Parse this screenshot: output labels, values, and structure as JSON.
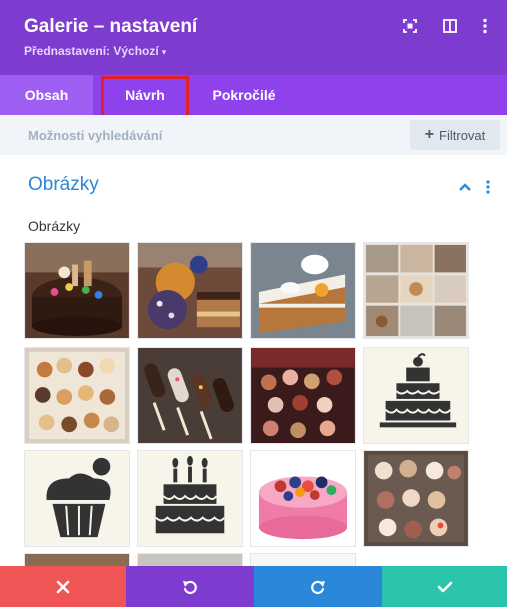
{
  "header": {
    "title": "Galerie – nastavení",
    "preset_label": "Přednastavení: Výchozí",
    "bg_color": "#7e3bd0"
  },
  "tabs": [
    {
      "label": "Obsah"
    },
    {
      "label": "Návrh",
      "highlighted": true
    },
    {
      "label": "Pokročilé"
    }
  ],
  "search": {
    "placeholder": "Možnosti vyhledávání",
    "filter_label": "Filtrovat"
  },
  "section": {
    "title": "Obrázky",
    "field_label": "Obrázky"
  },
  "images": [
    {
      "icon": "chocolate-cake-photo"
    },
    {
      "icon": "desserts-photo"
    },
    {
      "icon": "cake-slice-photo"
    },
    {
      "icon": "collage-photo"
    },
    {
      "icon": "cookies-box-photo"
    },
    {
      "icon": "chocolate-pops-photo"
    },
    {
      "icon": "chocolates-photo"
    },
    {
      "icon": "tiered-cake-icon"
    },
    {
      "icon": "cupcake-icon"
    },
    {
      "icon": "birthday-cake-icon"
    },
    {
      "icon": "berry-cake-photo"
    },
    {
      "icon": "cupcakes-box-photo"
    }
  ],
  "footer": {
    "buttons": [
      {
        "icon": "close-icon",
        "color": "#ef5555"
      },
      {
        "icon": "undo-icon",
        "color": "#7e3bd0"
      },
      {
        "icon": "redo-icon",
        "color": "#2b87da"
      },
      {
        "icon": "check-icon",
        "color": "#29c4a9"
      }
    ]
  },
  "colors": {
    "accent_blue": "#2b87da",
    "highlight_red": "#e0202d",
    "tab_bar": "#8f42ec"
  }
}
